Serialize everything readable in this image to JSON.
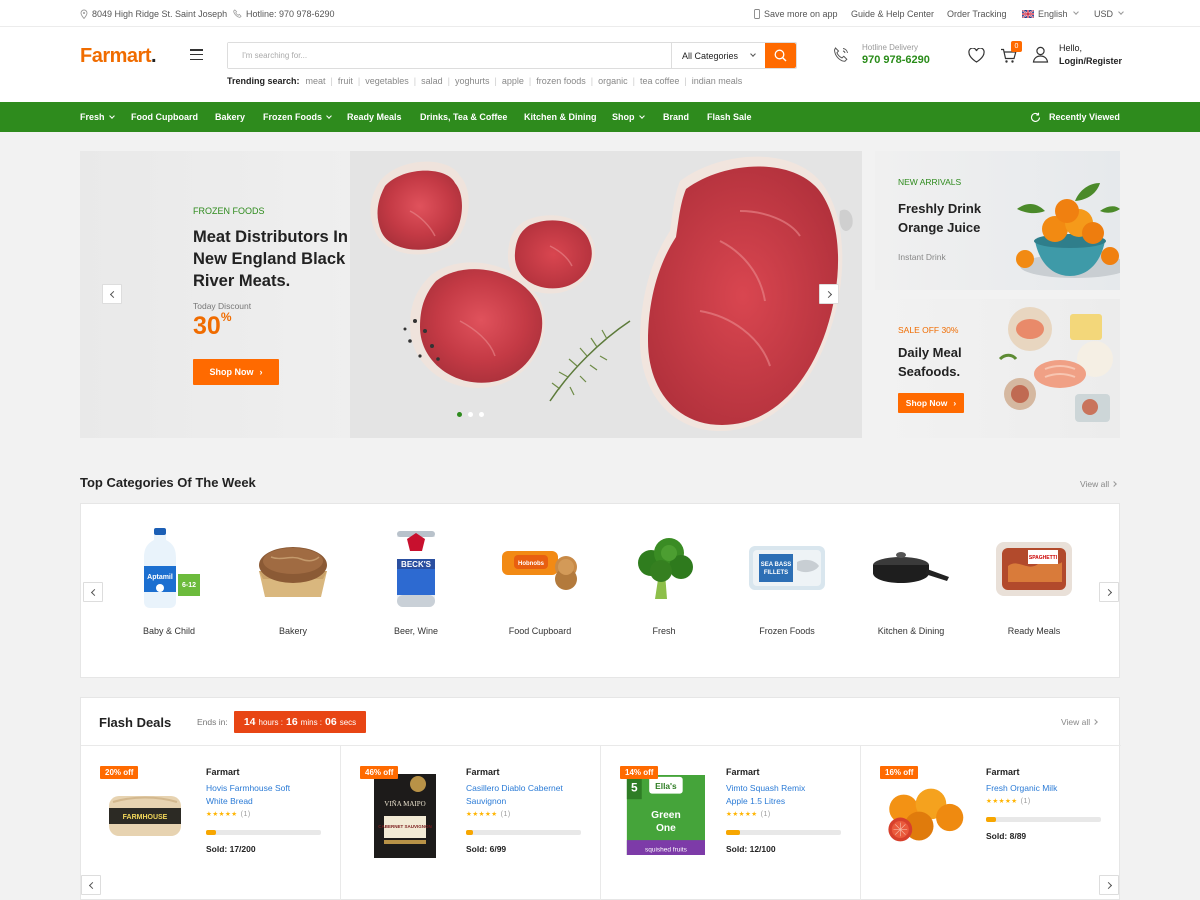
{
  "topbar": {
    "address": "8049 High Ridge St. Saint Joseph",
    "hotline": "Hotline: 970 978-6290",
    "save_app": "Save more on app",
    "guide": "Guide & Help Center",
    "order_tracking": "Order Tracking",
    "language": "English",
    "currency": "USD"
  },
  "header": {
    "logo_main": "Farmart",
    "logo_dot": ".",
    "search_placeholder": "I'm searching for...",
    "category_select": "All Categories",
    "trending_label": "Trending search:",
    "trending": [
      "meat",
      "fruit",
      "vegetables",
      "salad",
      "yoghurts",
      "apple",
      "frozen foods",
      "organic",
      "tea coffee",
      "indian meals"
    ],
    "hotline_label": "Hotline Delivery",
    "hotline_number": "970 978-6290",
    "cart_count": "0",
    "hello": "Hello,",
    "login": "Login/Register"
  },
  "nav": {
    "items": [
      "Fresh",
      "Food Cupboard",
      "Bakery",
      "Frozen Foods",
      "Ready Meals",
      "Drinks, Tea & Coffee",
      "Kitchen & Dining",
      "Shop",
      "Brand",
      "Flash Sale"
    ],
    "recently_viewed": "Recently Viewed"
  },
  "hero": {
    "label": "FROZEN FOODS",
    "title": "Meat Distributors In New England Black River Meats.",
    "discount_label": "Today Discount",
    "discount_value": "30",
    "discount_unit": "%",
    "button": "Shop Now",
    "slides": 3,
    "active_slide": 1
  },
  "side_banners": [
    {
      "label": "NEW ARRIVALS",
      "title": "Freshly Drink Orange Juice",
      "subtitle": "Instant Drink"
    },
    {
      "label": "SALE OFF 30%",
      "title": "Daily Meal Seafoods.",
      "button": "Shop Now"
    }
  ],
  "categories": {
    "title": "Top Categories Of The Week",
    "view_all": "View all",
    "items": [
      "Baby & Child",
      "Bakery",
      "Beer, Wine",
      "Food Cupboard",
      "Fresh",
      "Frozen Foods",
      "Kitchen & Dining",
      "Ready Meals"
    ]
  },
  "flash": {
    "title": "Flash Deals",
    "ends_in": "Ends in:",
    "hours": "14",
    "hours_label": "hours :",
    "mins": "16",
    "mins_label": "mins :",
    "secs": "06",
    "secs_label": "secs",
    "view_all": "View all",
    "products": [
      {
        "off": "20% off",
        "brand": "Farmart",
        "name": "Hovis Farmhouse Soft White Bread",
        "stars": "★★★★★",
        "reviews": "(1)",
        "progress": 0.085,
        "sold": "Sold: 17/200"
      },
      {
        "off": "46% off",
        "brand": "Farmart",
        "name": "Casillero Diablo Cabernet Sauvignon",
        "stars": "★★★★★",
        "reviews": "(1)",
        "progress": 0.06,
        "sold": "Sold: 6/99"
      },
      {
        "off": "14% off",
        "brand": "Farmart",
        "name": "Vimto Squash Remix Apple 1.5 Litres",
        "stars": "★★★★★",
        "reviews": "(1)",
        "progress": 0.12,
        "sold": "Sold: 12/100"
      },
      {
        "off": "16% off",
        "brand": "Farmart",
        "name": "Fresh Organic Milk",
        "stars": "★★★★★",
        "reviews": "(1)",
        "progress": 0.09,
        "sold": "Sold: 8/89"
      }
    ]
  },
  "colors": {
    "accent": "#ff6a00",
    "green": "#2e8b1d",
    "link": "#2b7bd6"
  }
}
